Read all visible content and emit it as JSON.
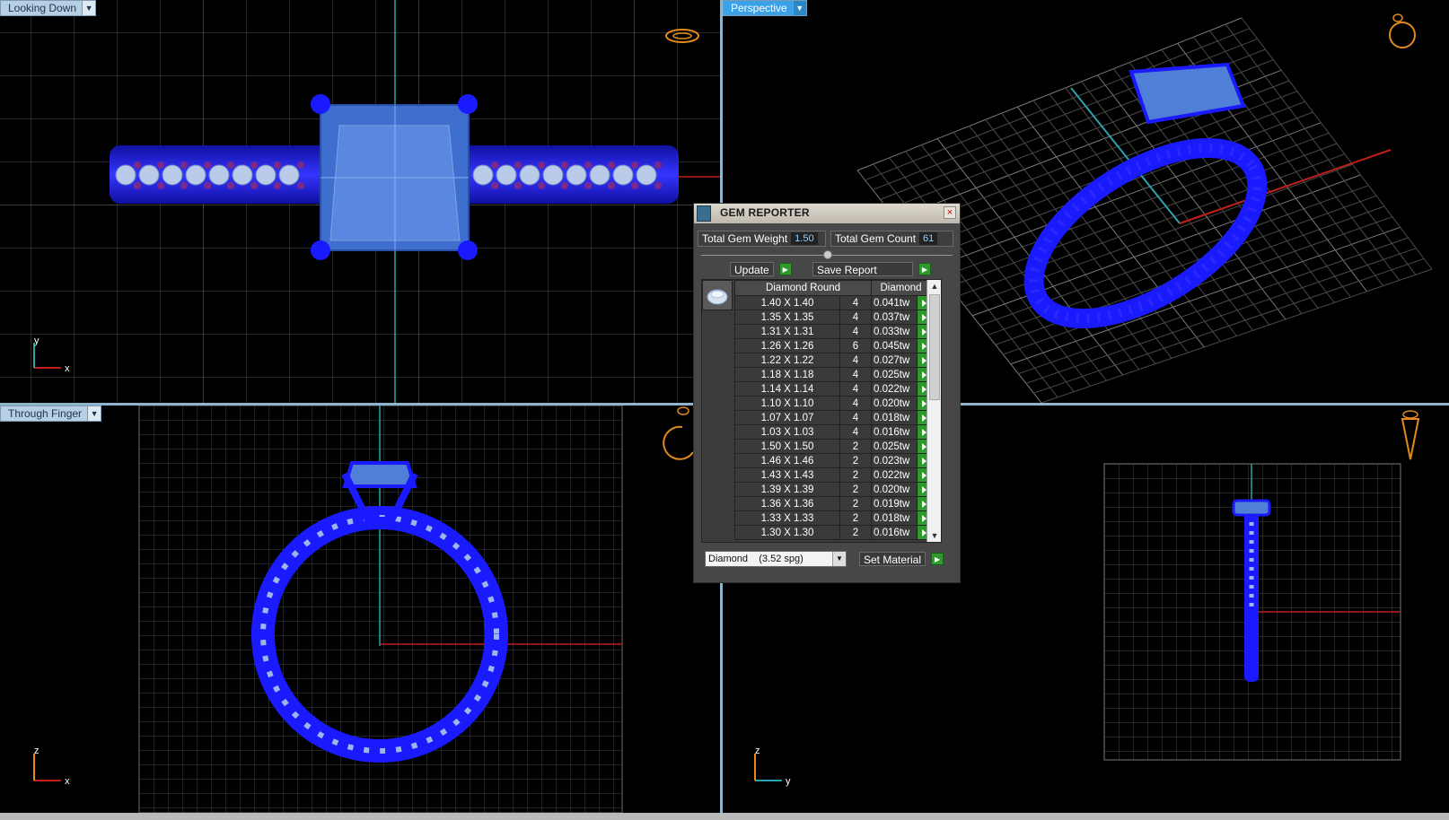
{
  "viewports": {
    "top_left": {
      "label": "Looking Down",
      "axis_x": "x",
      "axis_y": "y"
    },
    "top_right": {
      "label": "Perspective"
    },
    "bottom_left": {
      "label": "Through Finger",
      "axis_x": "x",
      "axis_y": "z"
    },
    "bottom_right": {
      "label": "",
      "axis_x": "y",
      "axis_y": "z"
    }
  },
  "gem_reporter": {
    "title": "GEM REPORTER",
    "close_symbol": "×",
    "total_weight_label": "Total Gem Weight",
    "total_weight_value": "1.50",
    "total_count_label": "Total Gem Count",
    "total_count_value": "61",
    "update_label": "Update",
    "save_report_label": "Save Report",
    "columns": [
      "Diamond Round",
      "Diamond"
    ],
    "rows": [
      {
        "size": "1.40 X 1.40",
        "count": "4",
        "weight": "0.041tw"
      },
      {
        "size": "1.35 X 1.35",
        "count": "4",
        "weight": "0.037tw"
      },
      {
        "size": "1.31 X 1.31",
        "count": "4",
        "weight": "0.033tw"
      },
      {
        "size": "1.26 X 1.26",
        "count": "6",
        "weight": "0.045tw"
      },
      {
        "size": "1.22 X 1.22",
        "count": "4",
        "weight": "0.027tw"
      },
      {
        "size": "1.18 X 1.18",
        "count": "4",
        "weight": "0.025tw"
      },
      {
        "size": "1.14 X 1.14",
        "count": "4",
        "weight": "0.022tw"
      },
      {
        "size": "1.10 X 1.10",
        "count": "4",
        "weight": "0.020tw"
      },
      {
        "size": "1.07 X 1.07",
        "count": "4",
        "weight": "0.018tw"
      },
      {
        "size": "1.03 X 1.03",
        "count": "4",
        "weight": "0.016tw"
      },
      {
        "size": "1.50 X 1.50",
        "count": "2",
        "weight": "0.025tw"
      },
      {
        "size": "1.46 X 1.46",
        "count": "2",
        "weight": "0.023tw"
      },
      {
        "size": "1.43 X 1.43",
        "count": "2",
        "weight": "0.022tw"
      },
      {
        "size": "1.39 X 1.39",
        "count": "2",
        "weight": "0.020tw"
      },
      {
        "size": "1.36 X 1.36",
        "count": "2",
        "weight": "0.019tw"
      },
      {
        "size": "1.33 X 1.33",
        "count": "2",
        "weight": "0.018tw"
      },
      {
        "size": "1.30 X 1.30",
        "count": "2",
        "weight": "0.016tw"
      }
    ],
    "material_value": "Diamond    (3.52 spg)",
    "set_material_label": "Set Material"
  },
  "colors": {
    "metal": "#1a1aff",
    "gem": "#4f7fd6",
    "grid": "#5a5a5a",
    "axis_red": "#c0201a",
    "axis_cyan": "#2aa3b0",
    "nav_icon": "#e08a1e"
  },
  "icons": {
    "nav": "ring-orientation-icon",
    "go": "green-arrow-icon",
    "thumb": "diamond-gem-icon"
  }
}
